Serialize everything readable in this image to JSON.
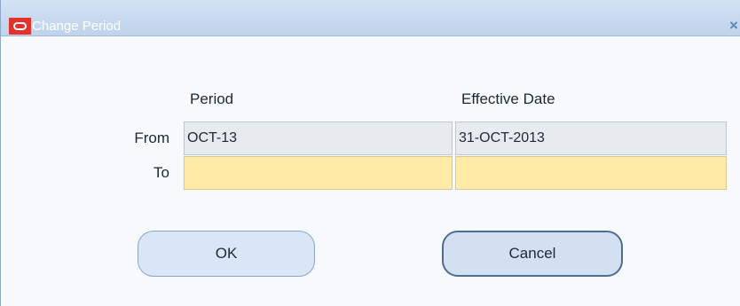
{
  "window": {
    "title": "Change Period",
    "icon": "oracle-logo-icon",
    "close_icon": "close-icon",
    "close_glyph": "×"
  },
  "form": {
    "headers": {
      "period": "Period",
      "effective_date": "Effective Date"
    },
    "rows": {
      "from": {
        "label": "From",
        "period_value": "OCT-13",
        "effective_date_value": "31-OCT-2013"
      },
      "to": {
        "label": "To",
        "period_value": "",
        "effective_date_value": ""
      }
    }
  },
  "buttons": {
    "ok": "OK",
    "cancel": "Cancel"
  },
  "colors": {
    "title_bar": "#c8d9ef",
    "readonly_field": "#e7ebf0",
    "editable_field": "#ffeaa6",
    "button_fill": "#d9e6f6",
    "icon_red": "#e2322c"
  }
}
